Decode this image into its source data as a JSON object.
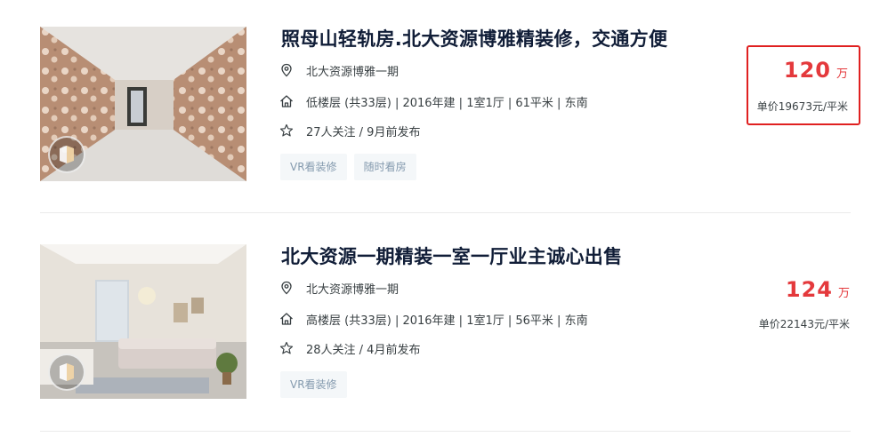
{
  "listings": [
    {
      "title": "照母山轻轨房.北大资源博雅精装修，交通方便",
      "address": "北大资源博雅一期",
      "house_info": "低楼层 (共33层) | 2016年建 | 1室1厅 | 61平米 | 东南",
      "follow_info": "27人关注 / 9月前发布",
      "tags": [
        "VR看装修",
        "随时看房"
      ],
      "total_price": "120",
      "total_unit": "万",
      "unit_price": "单价19673元/平米",
      "highlighted": true
    },
    {
      "title": "北大资源一期精装一室一厅业主诚心出售",
      "address": "北大资源博雅一期",
      "house_info": "高楼层 (共33层) | 2016年建 | 1室1厅 | 56平米 | 东南",
      "follow_info": "28人关注 / 4月前发布",
      "tags": [
        "VR看装修"
      ],
      "total_price": "124",
      "total_unit": "万",
      "unit_price": "单价22143元/平米",
      "highlighted": false
    }
  ],
  "icons": {
    "address": "location-pin-icon",
    "house": "house-icon",
    "follow": "star-icon",
    "vr": "vr-badge-icon"
  },
  "colors": {
    "price": "#e4393c",
    "highlight_border": "#e02020",
    "title": "#101d37",
    "tag_text": "#849aae",
    "tag_bg": "#f4f7f9"
  }
}
